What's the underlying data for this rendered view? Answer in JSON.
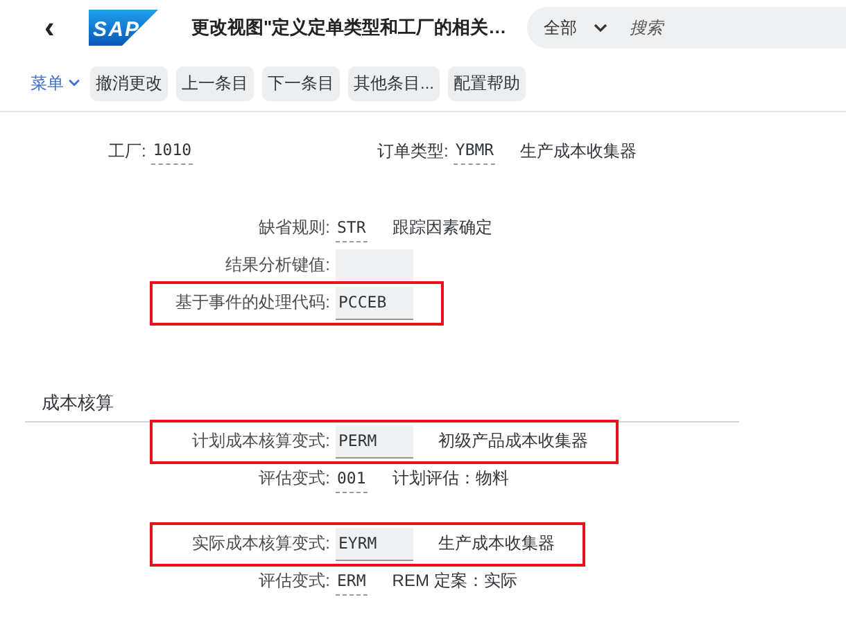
{
  "header": {
    "back": "‹",
    "logo": "SAP",
    "title": "更改视图\"定义定单类型和工厂的相关…",
    "search": {
      "scope": "全部",
      "placeholder": "搜索"
    }
  },
  "toolbar": {
    "menu": "菜单",
    "buttons": [
      "撤消更改",
      "上一条目",
      "下一条目",
      "其他条目...",
      "配置帮助"
    ]
  },
  "key_fields": [
    {
      "label": "工厂:",
      "value": "1010"
    },
    {
      "label": "订单类型:",
      "value": "YBMR",
      "description": "生产成本收集器"
    }
  ],
  "groups": [
    {
      "rows": [
        {
          "label": "缺省规则:",
          "kind": "display",
          "value": "STR",
          "description": "跟踪因素确定",
          "highlighted": false
        },
        {
          "label": "结果分析键值:",
          "kind": "input",
          "highlighted": false
        },
        {
          "label": "基于事件的处理代码:",
          "kind": "input",
          "value": "PCCEB",
          "highlighted": true
        }
      ]
    },
    {
      "section": "成本核算",
      "rows": [
        {
          "label": "计划成本核算变式:",
          "kind": "input",
          "value": "PERM",
          "description": "初级产品成本收集器",
          "highlighted": true
        },
        {
          "label": "评估变式:",
          "kind": "display",
          "value": "001",
          "description": "计划评估：物料",
          "highlighted": false
        }
      ]
    },
    {
      "rows": [
        {
          "label": "实际成本核算变式:",
          "kind": "input",
          "value": "EYRM",
          "description": "生产成本收集器",
          "highlighted": true
        },
        {
          "label": "评估变式:",
          "kind": "display",
          "value": "ERM",
          "description": "REM 定案：实际",
          "highlighted": false
        }
      ]
    }
  ]
}
